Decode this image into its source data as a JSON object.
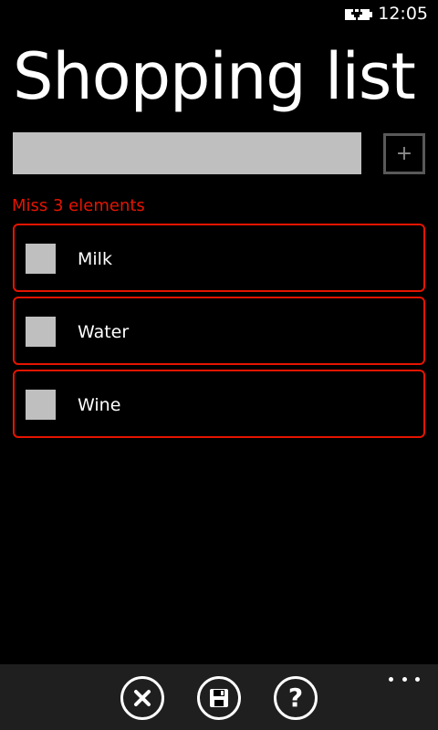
{
  "status_bar": {
    "time": "12:05",
    "battery_icon": "battery-charging-icon"
  },
  "title": "Shopping list",
  "input": {
    "value": "",
    "placeholder": "",
    "add_icon": "+"
  },
  "status_message": "Miss 3 elements",
  "items": [
    {
      "label": "Milk",
      "checked": false
    },
    {
      "label": "Water",
      "checked": false
    },
    {
      "label": "Wine",
      "checked": false
    }
  ],
  "app_bar": {
    "buttons": [
      {
        "icon": "close-circle-icon"
      },
      {
        "icon": "save-icon"
      },
      {
        "icon": "help-icon",
        "glyph": "?"
      }
    ],
    "more_icon": "ellipsis-icon"
  },
  "colors": {
    "background": "#000000",
    "accent": "#e51400",
    "input_fill": "#bfbfbf",
    "app_bar": "#1f1f1f"
  }
}
